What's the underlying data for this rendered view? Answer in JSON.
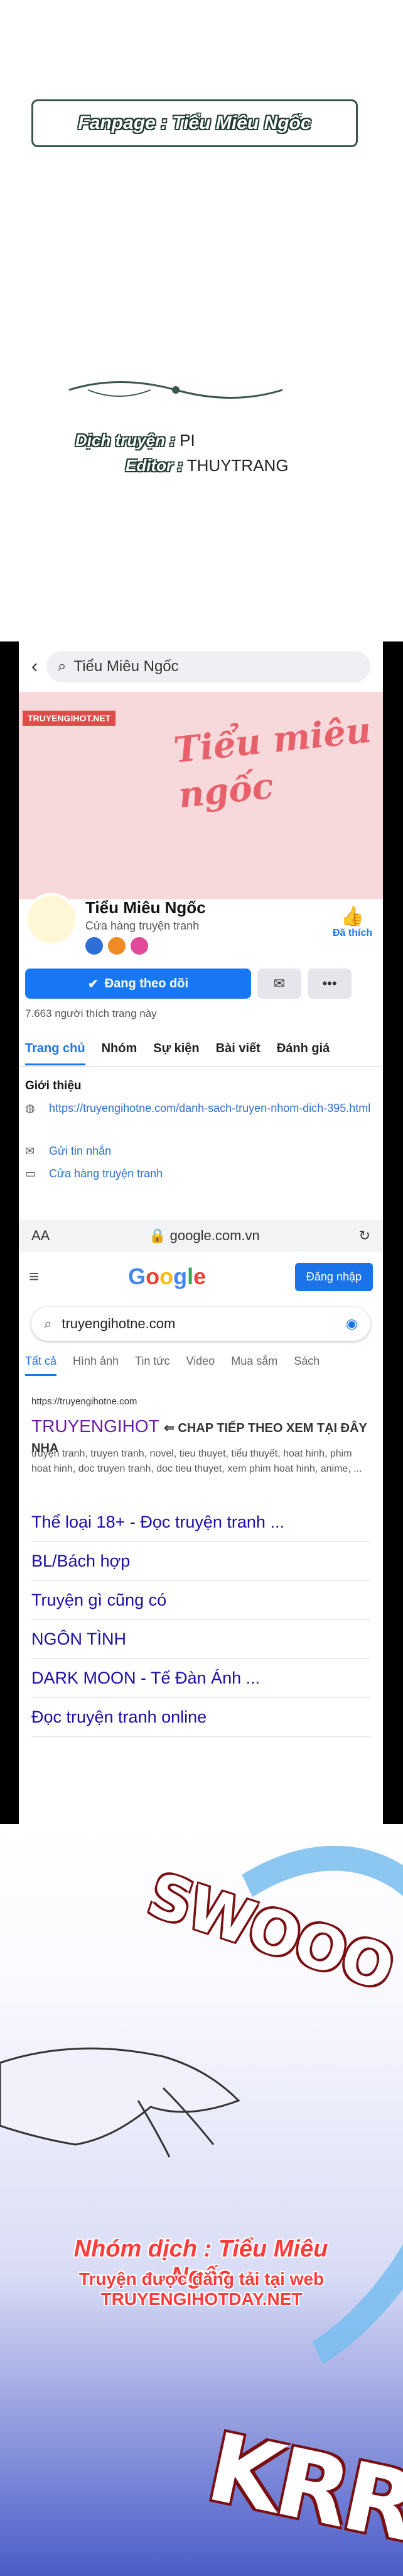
{
  "top_banner": {
    "text": "Fanpage : Tiểu Miêu Ngốc"
  },
  "credits": {
    "translator_label": "Dịch truyện :",
    "translator": "PI",
    "editor_label": "Editor :",
    "editor": "THUYTRANG"
  },
  "phone": {
    "search_text": "Tiểu Miêu Ngốc",
    "cover_tag": "TRUYENGIHOT.NET",
    "cover_script": "Tiểu miêu ngốc",
    "page_name": "Tiểu Miêu Ngốc",
    "category": "Cửa hàng truyện tranh",
    "like_label": "Đã thích",
    "follow_label": "Đang theo dõi",
    "likes_count": "7.663 người thích trang này",
    "tabs": [
      "Trang chủ",
      "Nhóm",
      "Sự kiện",
      "Bài viết",
      "Đánh giá"
    ],
    "intro_heading": "Giới thiệu",
    "intro_link": "https://truyengihotne.com/danh-sach-truyen-nhom-dich-395.html",
    "intro_message": "Gửi tin nhắn",
    "intro_shop": "Cửa hàng truyện tranh",
    "url_aa": "AA",
    "url_domain": "google.com.vn",
    "google_logo": "Google",
    "signin_label": "Đăng nhập",
    "google_query": "truyengihotne.com",
    "google_tabs": [
      "Tất cả",
      "Hình ảnh",
      "Tin tức",
      "Video",
      "Mua sắm",
      "Sách"
    ],
    "result_site": "https://truyengihotne.com",
    "result_title": "TRUYENGIHOT",
    "result_note": "⇐ CHAP TIẾP THEO XEM TẠI ĐÂY NHA",
    "snippet": "truyện tranh, truyen tranh, novel, tieu thuyet, tiểu thuyết, hoat hinh, phim hoat hinh, doc truyen tranh, doc tieu thuyet, xem phim hoat hinh, anime, ...",
    "links": [
      "Thể loại 18+ - Đọc truyện tranh ...",
      "BL/Bách hợp",
      "Truyện gì cũng có",
      "NGÔN TÌNH",
      "DARK MOON - Tế Đàn Ánh ...",
      "Đọc truyện tranh online"
    ]
  },
  "manga": {
    "sfx1": "SWOOO",
    "credit_line1": "Nhóm dịch : Tiểu Miêu Ngốc",
    "credit_line2": "Truyện được đăng tải tại web TRUYENGIHOTDAY.NET",
    "sfx2": "KRRR"
  }
}
